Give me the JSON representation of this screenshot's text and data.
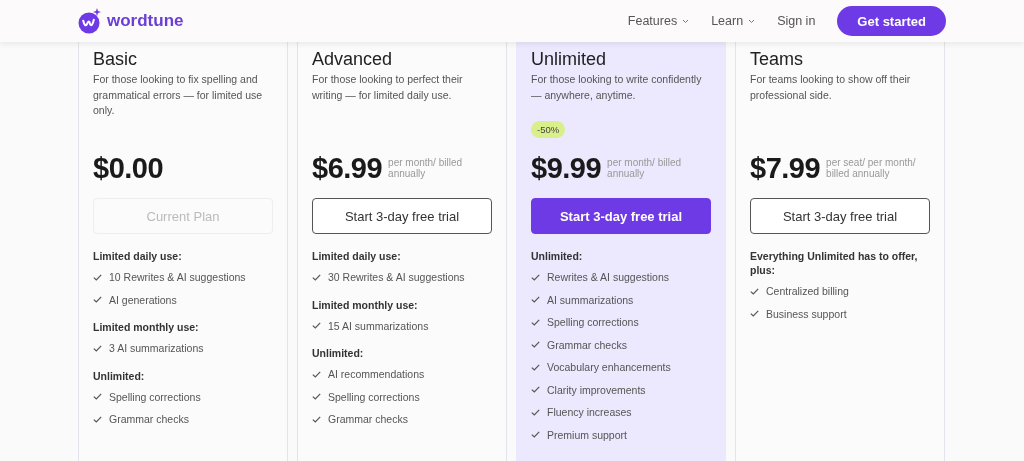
{
  "header": {
    "logo": "wordtune",
    "nav": [
      {
        "label": "Features",
        "dropdown": true
      },
      {
        "label": "Learn",
        "dropdown": true
      },
      {
        "label": "Sign in",
        "dropdown": false
      }
    ],
    "cta": "Get started"
  },
  "plans": [
    {
      "name": "Basic",
      "description": "For those looking to fix spelling and grammatical errors — for limited use only.",
      "highlighted": false,
      "price": "$0.00",
      "button": {
        "label": "Current Plan",
        "kind": "disabled"
      },
      "sections": [
        {
          "heading": "Limited daily use:",
          "items": [
            "10 Rewrites & AI suggestions",
            "AI generations"
          ]
        },
        {
          "heading": "Limited monthly use:",
          "items": [
            "3 AI summarizations"
          ]
        },
        {
          "heading": "Unlimited:",
          "items": [
            "Spelling corrections",
            "Grammar checks"
          ]
        }
      ]
    },
    {
      "name": "Advanced",
      "description": "For those looking to perfect their writing — for limited daily use.",
      "highlighted": false,
      "price": "$6.99",
      "price_note": "per month/  billed annually",
      "button": {
        "label": "Start 3-day free trial",
        "kind": "outline"
      },
      "sections": [
        {
          "heading": "Limited daily use:",
          "items": [
            "30 Rewrites & AI suggestions"
          ]
        },
        {
          "heading": "Limited monthly use:",
          "items": [
            "15 AI summarizations"
          ]
        },
        {
          "heading": "Unlimited:",
          "items": [
            "AI recommendations",
            "Spelling corrections",
            "Grammar checks"
          ]
        }
      ]
    },
    {
      "name": "Unlimited",
      "description": "For those looking to write confidently — anywhere, anytime.",
      "badge": "-50%",
      "highlighted": true,
      "price": "$9.99",
      "price_note": "per month/  billed annually",
      "button": {
        "label": "Start 3-day free trial",
        "kind": "primary"
      },
      "sections": [
        {
          "heading": "Unlimited:",
          "items": [
            "Rewrites & AI suggestions",
            "AI summarizations",
            "Spelling corrections",
            "Grammar checks",
            "Vocabulary enhancements",
            "Clarity improvements",
            "Fluency increases",
            "Premium support"
          ]
        }
      ]
    },
    {
      "name": "Teams",
      "description": "For teams looking to show off their professional side.",
      "highlighted": false,
      "price": "$7.99",
      "price_note": "per seat/ per month/ billed annually",
      "button": {
        "label": "Start 3-day free trial",
        "kind": "outline"
      },
      "sections": [
        {
          "heading": "Everything Unlimited has to offer, plus:",
          "items": [
            "Centralized billing",
            "Business support"
          ]
        }
      ]
    }
  ]
}
